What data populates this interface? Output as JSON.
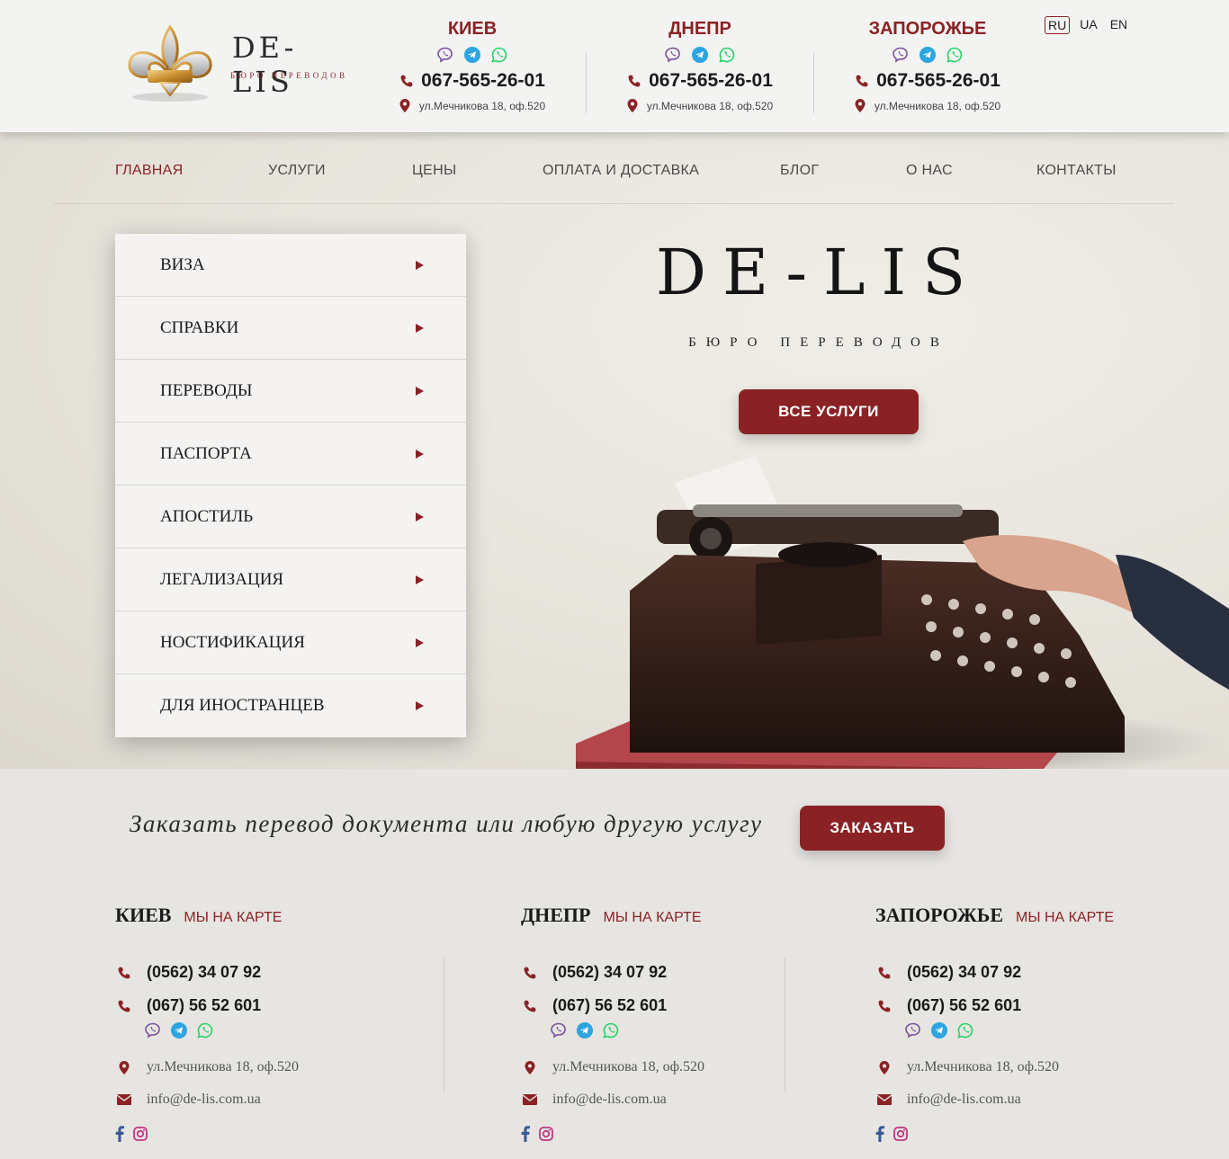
{
  "header": {
    "logo": {
      "name": "DE-LIS",
      "subtitle": "бюро переводов",
      "emblem_text": "De-Lis"
    },
    "cities": [
      {
        "name": "КИЕВ",
        "phone": "067-565-26-01",
        "address": "ул.Мечникова 18, оф.520"
      },
      {
        "name": "ДНЕПР",
        "phone": "067-565-26-01",
        "address": "ул.Мечникова 18, оф.520"
      },
      {
        "name": "ЗАПОРОЖЬЕ",
        "phone": "067-565-26-01",
        "address": "ул.Мечникова 18, оф.520"
      }
    ],
    "languages": [
      "RU",
      "UA",
      "EN"
    ],
    "active_language": "RU"
  },
  "nav": {
    "items": [
      "ГЛАВНАЯ",
      "УСЛУГИ",
      "ЦЕНЫ",
      "ОПЛАТА И ДОСТАВКА",
      "БЛОГ",
      "О НАС",
      "КОНТАКТЫ"
    ],
    "active": "ГЛАВНАЯ"
  },
  "side_menu": [
    "ВИЗА",
    "СПРАВКИ",
    "ПЕРЕВОДЫ",
    "ПАСПОРТА",
    "АПОСТИЛЬ",
    "ЛЕГАЛИЗАЦИЯ",
    "НОСТИФИКАЦИЯ",
    "ДЛЯ ИНОСТРАНЦЕВ"
  ],
  "hero": {
    "title": "DE-LIS",
    "subtitle": "бюро переводов",
    "button": "ВСЕ УСЛУГИ"
  },
  "order": {
    "text": "Заказать перевод документа или любую другую услугу",
    "button": "ЗАКАЗАТЬ"
  },
  "footer": {
    "map_label": "МЫ НА КАРТЕ",
    "columns": [
      {
        "city": "КИЕВ",
        "phone1": "(0562) 34 07 92",
        "phone2": "(067) 56 52 601",
        "address": "ул.Мечникова 18, оф.520",
        "email": "info@de-lis.com.ua"
      },
      {
        "city": "ДНЕПР",
        "phone1": "(0562) 34 07 92",
        "phone2": "(067) 56 52 601",
        "address": "ул.Мечникова 18, оф.520",
        "email": "info@de-lis.com.ua"
      },
      {
        "city": "ЗАПОРОЖЬЕ",
        "phone1": "(0562) 34 07 92",
        "phone2": "(067) 56 52 601",
        "address": "ул.Мечникова 18, оф.520",
        "email": "info@de-lis.com.ua"
      }
    ]
  },
  "colors": {
    "brand": "#8a2225",
    "viber": "#7b519d",
    "telegram": "#2ca5e0",
    "whatsapp": "#25d366",
    "facebook": "#3b5998",
    "instagram": "#c13584"
  },
  "icons": {
    "phone": "phone-icon",
    "location": "location-pin-icon",
    "email": "envelope-icon",
    "viber": "viber-icon",
    "telegram": "telegram-icon",
    "whatsapp": "whatsapp-icon",
    "facebook": "facebook-icon",
    "instagram": "instagram-icon"
  }
}
